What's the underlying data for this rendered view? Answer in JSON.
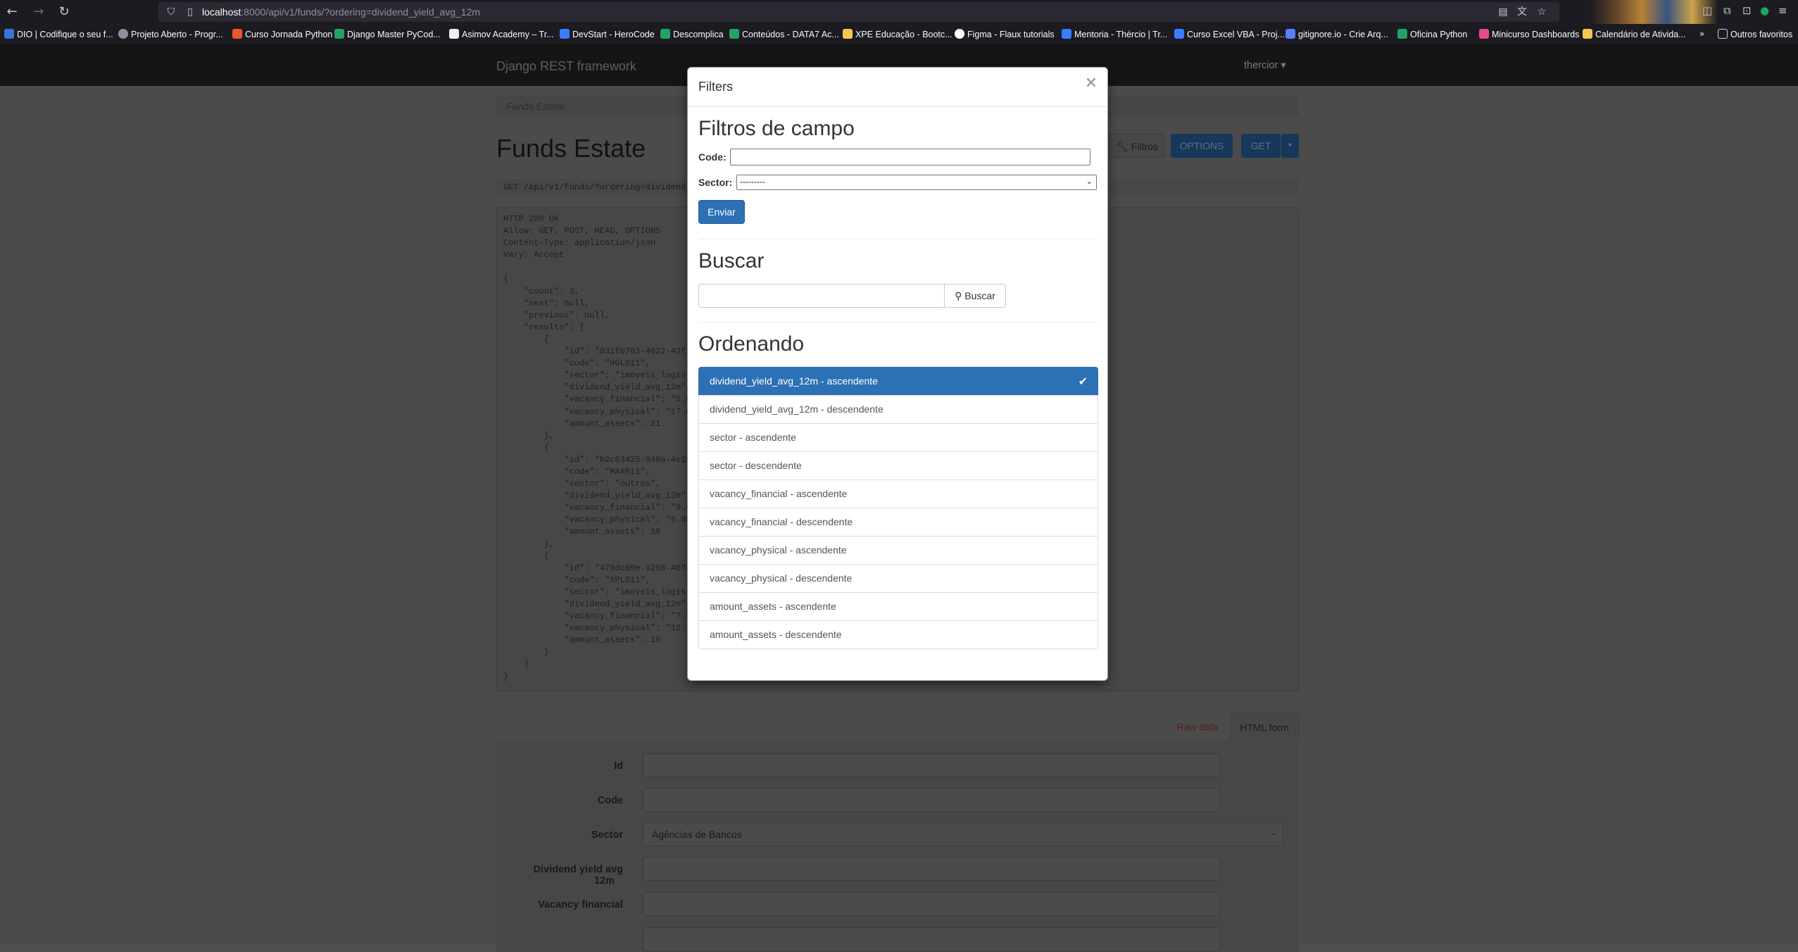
{
  "browser": {
    "url_host": "localhost",
    "url_rest": ":8000/api/v1/funds/?ordering=dividend_yield_avg_12m",
    "bookmarks": [
      "DIO | Codifique o seu f...",
      "Projeto Aberto - Progr...",
      "Curso Jornada Python",
      "Django Master PyCod...",
      "Asimov Academy – Tr...",
      "DevStart - HeroCode",
      "Descomplica",
      "Conteúdos - DATA7 Ac...",
      "XPE Educação - Bootc...",
      "Figma - Flaux tutorials",
      "Mentoria - Thércio | Tr...",
      "Curso Excel VBA - Proj...",
      "gitignore.io - Crie Arq...",
      "Oficina Python",
      "Minicurso Dashboards",
      "Calendário de Ativida..."
    ],
    "other_bookmarks": "Outros favoritos",
    "colors": [
      "#3a74d8",
      "#8f8f9d",
      "#e8562a",
      "#1fa463",
      "#f0f0f0",
      "#3b7cff",
      "#1fa463",
      "#1fa463",
      "#f2c94c",
      "#ffffff",
      "#3b7cff",
      "#3b7cff",
      "#5a7cff",
      "#1fa463",
      "#e44d8a",
      "#f2c94c"
    ]
  },
  "drf": {
    "brand": "Django REST framework",
    "user": "thercior ▾",
    "breadcrumb": "Funds Estate",
    "title": "Funds Estate",
    "btn_filtros": "Filtros",
    "btn_options": "OPTIONS",
    "btn_get": "GET",
    "request_line": "GET  /api/v1/funds/?ordering=dividend_y",
    "response_lines": [
      "HTTP 200 OK",
      "Allow: GET, POST, HEAD, OPTIONS",
      "Content-Type: application/json",
      "Vary: Accept",
      "",
      "{",
      "    \"count\": 3,",
      "    \"next\": null,",
      "    \"previous\": null,",
      "    \"results\": [",
      "        {",
      "            \"id\": \"031fb703-4622-43ff",
      "            \"code\": \"HGLG11\",",
      "            \"sector\": \"imoveis_logist",
      "            \"dividend_yield_avg_12m\": ",
      "            \"vacancy_financial\": \"5.00",
      "            \"vacancy_physical\": \"17.00",
      "            \"amount_assets\": 21",
      "        },",
      "        {",
      "            \"id\": \"b2c63425-848a-4e18",
      "            \"code\": \"MAXR11\",",
      "            \"sector\": \"outros\",",
      "            \"dividend_yield_avg_12m\": ",
      "            \"vacancy_financial\": \"0.00",
      "            \"vacancy_physical\": \"5.00\"",
      "            \"amount_assets\": 10",
      "        },",
      "        {",
      "            \"id\": \"478dc69e-9298-4074",
      "            \"code\": \"XPLG11\",",
      "            \"sector\": \"imoveis_logist",
      "            \"dividend_yield_avg_12m\": ",
      "            \"vacancy_financial\": \"7.81",
      "            \"vacancy_physical\": \"12.30",
      "            \"amount_assets\": 19",
      "        }",
      "    ]",
      "}"
    ],
    "tab_raw": "Raw data",
    "tab_html": "HTML form",
    "form": {
      "id_label": "Id",
      "code_label": "Code",
      "sector_label": "Sector",
      "sector_value": "Agências de Bancos",
      "dy_label_1": "Dividend yield avg",
      "dy_label_2": "12m",
      "vf_label": "Vacancy financial"
    }
  },
  "modal": {
    "title": "Filters",
    "close": "×",
    "field_filters_heading": "Filtros de campo",
    "code_label": "Code:",
    "code_value": "",
    "sector_label": "Sector:",
    "sector_value": "---------",
    "submit": "Enviar",
    "search_heading": "Buscar",
    "search_value": "",
    "search_button": "Buscar",
    "ordering_heading": "Ordenando",
    "ordering_options": [
      "dividend_yield_avg_12m - ascendente",
      "dividend_yield_avg_12m - descendente",
      "sector - ascendente",
      "sector - descendente",
      "vacancy_financial - ascendente",
      "vacancy_financial - descendente",
      "vacancy_physical - ascendente",
      "vacancy_physical - descendente",
      "amount_assets - ascendente",
      "amount_assets - descendente"
    ],
    "active_index": 0,
    "accent": "#2c70b5"
  }
}
